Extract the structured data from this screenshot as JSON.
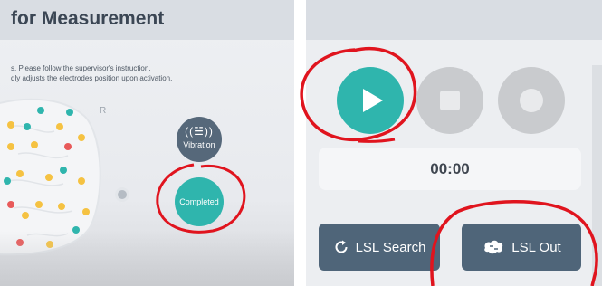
{
  "left_panel": {
    "title": "for Measurement",
    "instruction_line1": "s. Please follow the supervisor's instruction.",
    "instruction_line2": "dly adjusts the electrodes position upon activation.",
    "side_label": "R",
    "vibration_icon": "((☱))",
    "vibration_label": "Vibration",
    "completed_label": "Completed"
  },
  "right_panel": {
    "timer": "00:00",
    "lsl_search_label": "LSL Search",
    "lsl_out_label": "LSL Out"
  },
  "icons": [
    "play-icon",
    "stop-icon",
    "record-icon",
    "refresh-icon",
    "brain-icon",
    "vibration-icon"
  ],
  "colors": {
    "accent_teal": "#2fb5ad",
    "button_slate": "#4f6579",
    "annotation_red": "#e0141e"
  }
}
